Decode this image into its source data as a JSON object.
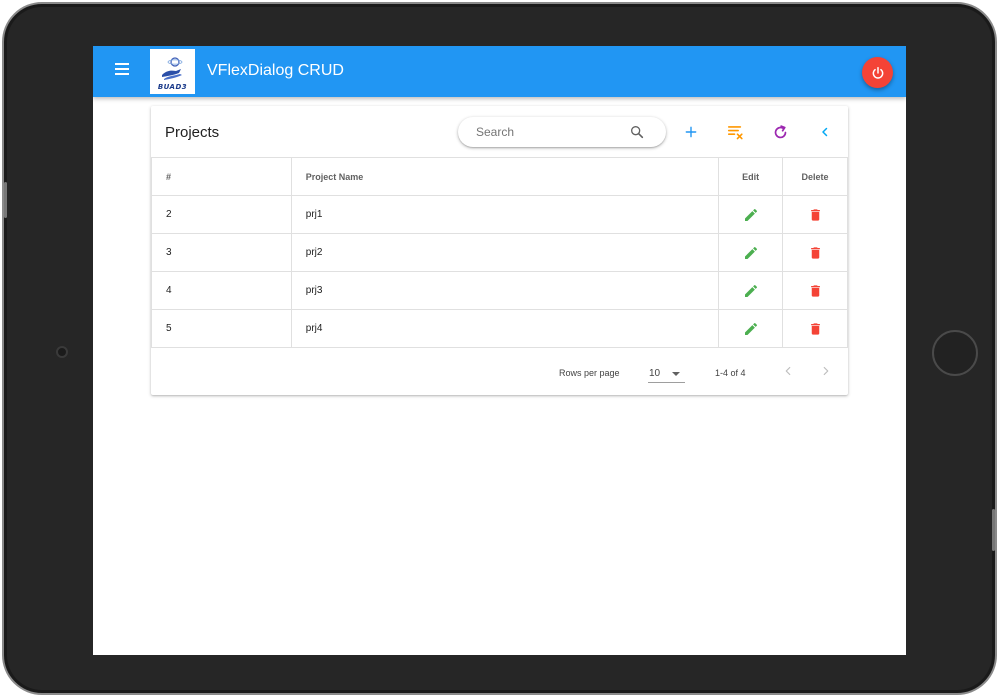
{
  "app": {
    "title": "VFlexDialog CRUD",
    "logo_text": "BUAD3",
    "colors": {
      "appbar": "#2196F3",
      "power": "#F44336",
      "add": "#2196F3",
      "clear_filter": "#FF9800",
      "refresh": "#9C27B0",
      "collapse": "#03A9F4",
      "edit": "#4CAF50",
      "delete": "#F44336"
    }
  },
  "icons": {
    "menu": "menu-icon",
    "power": "power-icon",
    "search": "search-icon",
    "add": "plus-icon",
    "clear_filter": "filter-remove-icon",
    "refresh": "refresh-icon",
    "collapse": "chevron-left-icon",
    "edit": "pencil-icon",
    "delete": "trash-icon"
  },
  "card": {
    "title": "Projects",
    "search_placeholder": "Search"
  },
  "table": {
    "headers": [
      "#",
      "Project Name",
      "Edit",
      "Delete"
    ],
    "rows": [
      {
        "id": "2",
        "name": "prj1"
      },
      {
        "id": "3",
        "name": "prj2"
      },
      {
        "id": "4",
        "name": "prj3"
      },
      {
        "id": "5",
        "name": "prj4"
      }
    ]
  },
  "footer": {
    "rows_per_page_label": "Rows per page",
    "rows_per_page_value": "10",
    "range_text": "1-4 of 4"
  }
}
